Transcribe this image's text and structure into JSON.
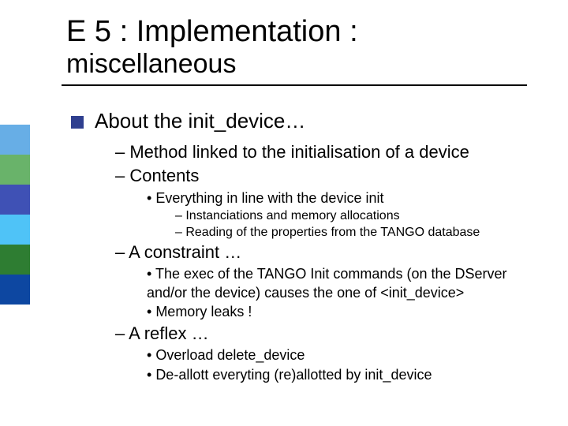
{
  "title": {
    "main": "E 5 : Implementation :",
    "sub": "miscellaneous"
  },
  "deco_colors": [
    "#67aee6",
    "#69b36a",
    "#3f51b5",
    "#4fc3f7",
    "#2e7d32",
    "#0d47a1"
  ],
  "content": {
    "lvl1": "About the init_device…",
    "a": "Method linked to the initialisation of a device",
    "b": "Contents",
    "b1": "Everything in line with the device init",
    "b1a": "Instanciations and memory allocations",
    "b1b": "Reading of the properties from the TANGO database",
    "c": "A constraint …",
    "c1": "The exec of the TANGO Init commands (on the DServer and/or the device) causes the one of <init_device>",
    "c2": "Memory leaks !",
    "d": "A reflex …",
    "d1": "Overload delete_device",
    "d2": "De-allott everyting  (re)allotted by init_device"
  }
}
